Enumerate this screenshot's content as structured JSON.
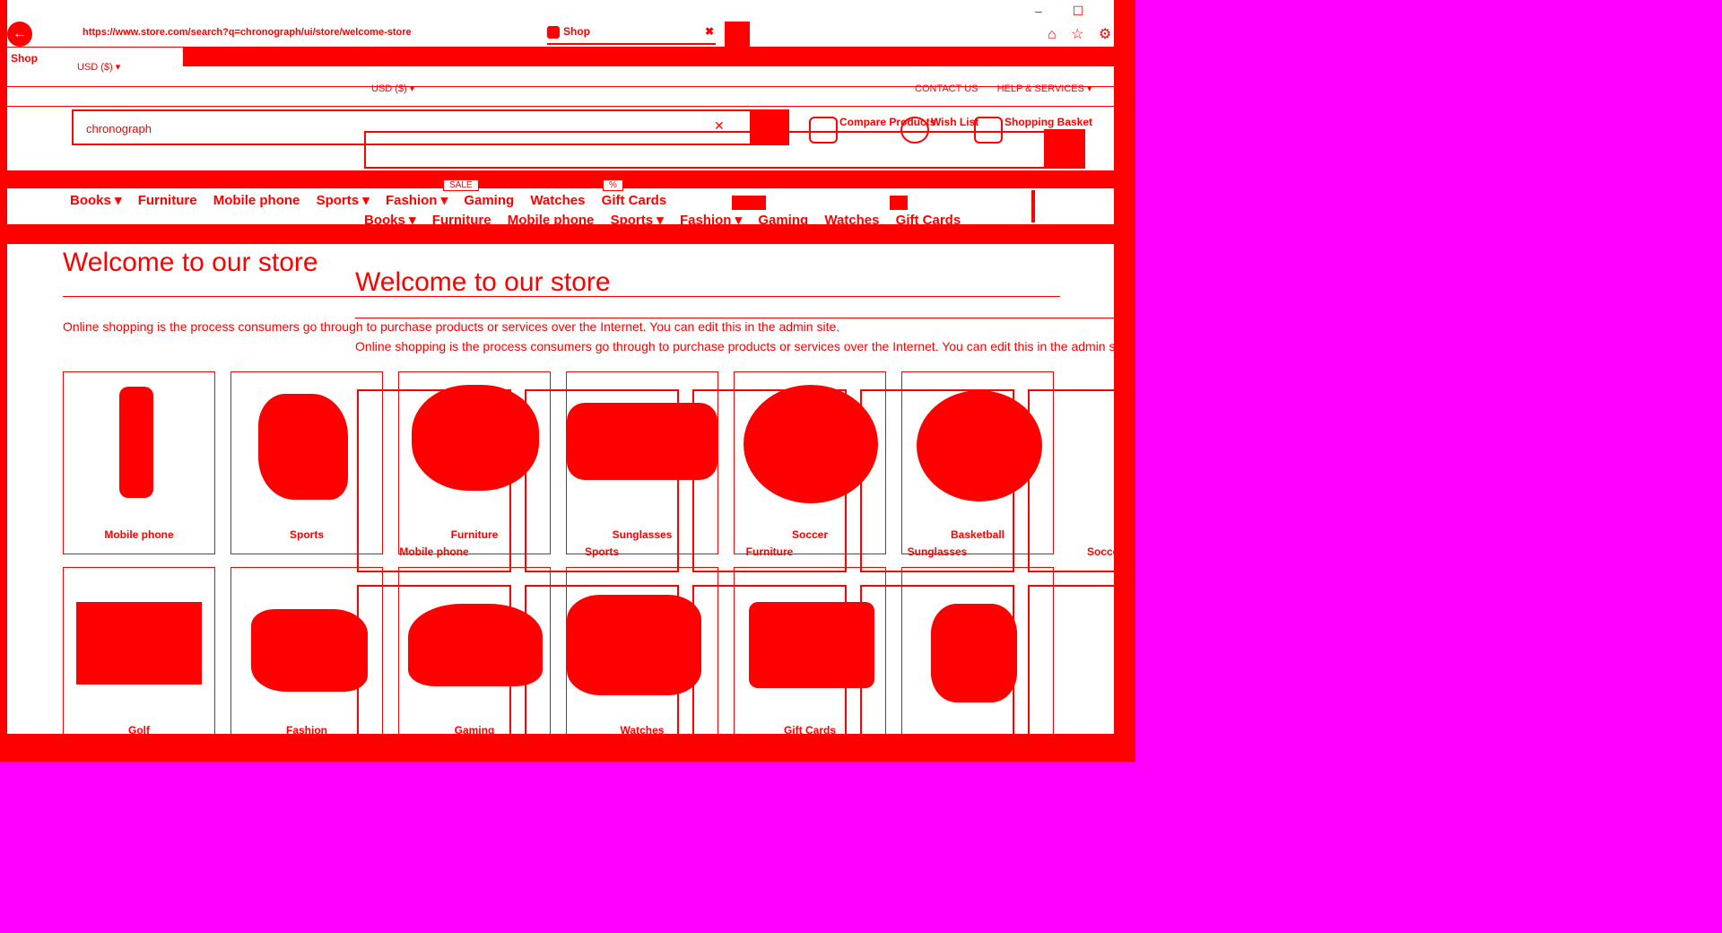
{
  "browser": {
    "url": "https://www.store.com/search?q=chronograph/ui/store/welcome-store",
    "tab_title": "Shop",
    "tab_close": "✖",
    "minimize": "–",
    "maximize": "☐",
    "close": "✕",
    "toolbar_icons": "⌂ ☆ ⚙"
  },
  "header": {
    "shop_label": "Shop",
    "currency": "USD ($) ▾",
    "currency_secondary": "USD  ($) ▾",
    "top_links": [
      "CONTACT US",
      "HELP & SERVICES ▾"
    ],
    "search_value": "chronograph",
    "search_clear": "✕",
    "compare": "Compare Products",
    "wishlist": "Wish List",
    "basket": "Shopping Basket"
  },
  "nav": {
    "items": [
      "Books ▾",
      "Furniture",
      "Mobile phone",
      "Sports ▾",
      "Fashion ▾",
      "Gaming",
      "Watches",
      "Gift Cards"
    ],
    "sale_badge": "SALE",
    "percent_badge": "%"
  },
  "main": {
    "title": "Welcome to our store",
    "intro": "Online shopping is the process consumers go through to purchase products or services over the Internet. You can edit this in the admin site."
  },
  "categories_row1": [
    "Mobile phone",
    "Sports",
    "Furniture",
    "Sunglasses",
    "Soccer",
    "Basketball"
  ],
  "categories_row2": [
    "Golf",
    "Fashion",
    "Gaming",
    "Watches",
    "Gift Cards",
    ""
  ],
  "colors": {
    "accent": "#ff0000",
    "background": "#ff00ff"
  }
}
